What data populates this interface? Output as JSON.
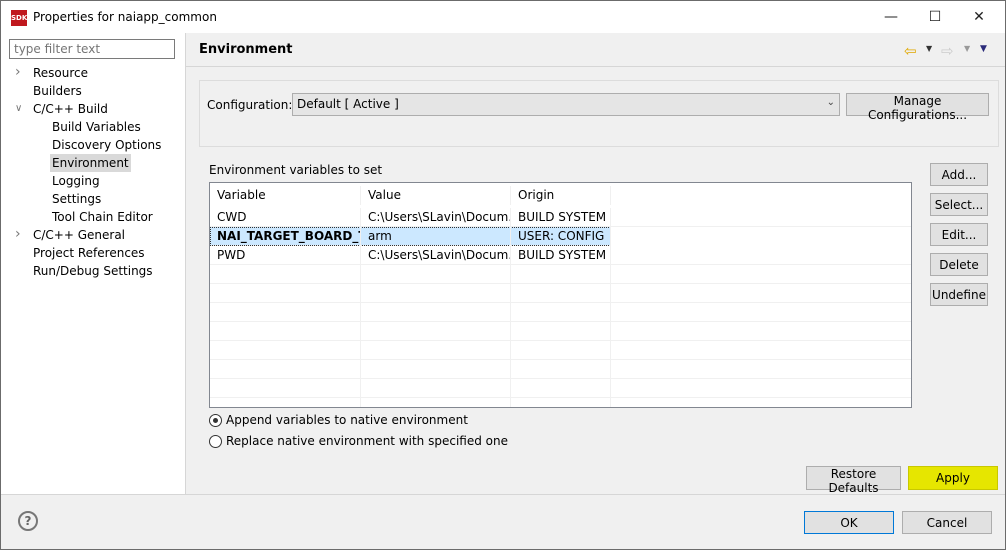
{
  "window": {
    "title": "Properties for naiapp_common",
    "logo_text": "SDK"
  },
  "filter": {
    "placeholder": "type filter text"
  },
  "tree": [
    {
      "label": "Resource",
      "indent": 0,
      "expander": "collapsed"
    },
    {
      "label": "Builders",
      "indent": 0
    },
    {
      "label": "C/C++ Build",
      "indent": 0,
      "expander": "expanded"
    },
    {
      "label": "Build Variables",
      "indent": 1
    },
    {
      "label": "Discovery Options",
      "indent": 1
    },
    {
      "label": "Environment",
      "indent": 1,
      "selected": true
    },
    {
      "label": "Logging",
      "indent": 1
    },
    {
      "label": "Settings",
      "indent": 1
    },
    {
      "label": "Tool Chain Editor",
      "indent": 1
    },
    {
      "label": "C/C++ General",
      "indent": 0,
      "expander": "collapsed"
    },
    {
      "label": "Project References",
      "indent": 0
    },
    {
      "label": "Run/Debug Settings",
      "indent": 0
    }
  ],
  "page": {
    "title": "Environment"
  },
  "config": {
    "label": "Configuration:",
    "value": "Default  [ Active ]",
    "manage": "Manage Configurations..."
  },
  "env": {
    "label": "Environment variables to set",
    "columns": [
      "Variable",
      "Value",
      "Origin"
    ],
    "rows": [
      [
        "CWD",
        "C:\\Users\\SLavin\\Docum...",
        "BUILD SYSTEM"
      ],
      [
        "NAI_TARGET_BOARD_T...",
        "arm",
        "USER: CONFIG"
      ],
      [
        "PWD",
        "C:\\Users\\SLavin\\Docum...",
        "BUILD SYSTEM"
      ]
    ],
    "selected_row": 1
  },
  "side_buttons": [
    "Add...",
    "Select...",
    "Edit...",
    "Delete",
    "Undefine"
  ],
  "radios": [
    {
      "label": "Append variables to native environment",
      "checked": true
    },
    {
      "label": "Replace native environment with specified one",
      "checked": false
    }
  ],
  "buttons": {
    "restore": "Restore Defaults",
    "apply": "Apply",
    "ok": "OK",
    "cancel": "Cancel"
  },
  "colors": {
    "apply": "#e6e600",
    "selection": "#cce8ff"
  }
}
